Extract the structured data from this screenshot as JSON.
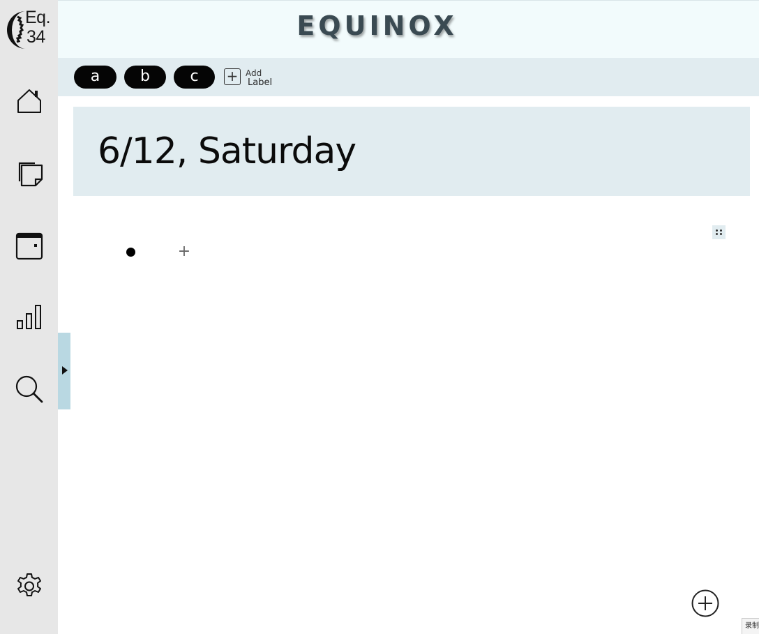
{
  "app": {
    "logo_text_line1": "Eq.",
    "logo_text_line2": "34",
    "title": "EQUINOX"
  },
  "sidebar": {
    "items": [
      {
        "name": "home",
        "icon": "home-icon"
      },
      {
        "name": "notes",
        "icon": "sticky-note-icon"
      },
      {
        "name": "calendar",
        "icon": "calendar-icon"
      },
      {
        "name": "stats",
        "icon": "bar-chart-icon"
      },
      {
        "name": "search",
        "icon": "search-icon"
      }
    ],
    "bottom_icon": "settings-gear-icon"
  },
  "labels": {
    "chips": [
      "a",
      "b",
      "c"
    ],
    "add_label_line1": "Add",
    "add_label_line2": "Label",
    "add_icon_glyph": "+"
  },
  "day": {
    "heading": "6/12, Saturday"
  },
  "list": {
    "add_glyph": "+"
  },
  "corner": {
    "badge_text": "录制"
  },
  "colors": {
    "sidebar_bg": "#e7e7e7",
    "header_bg": "#f2fbfc",
    "panel_bg": "#e1ecf0",
    "handle_bg": "#b9d8e2",
    "chip_bg": "#050505"
  }
}
